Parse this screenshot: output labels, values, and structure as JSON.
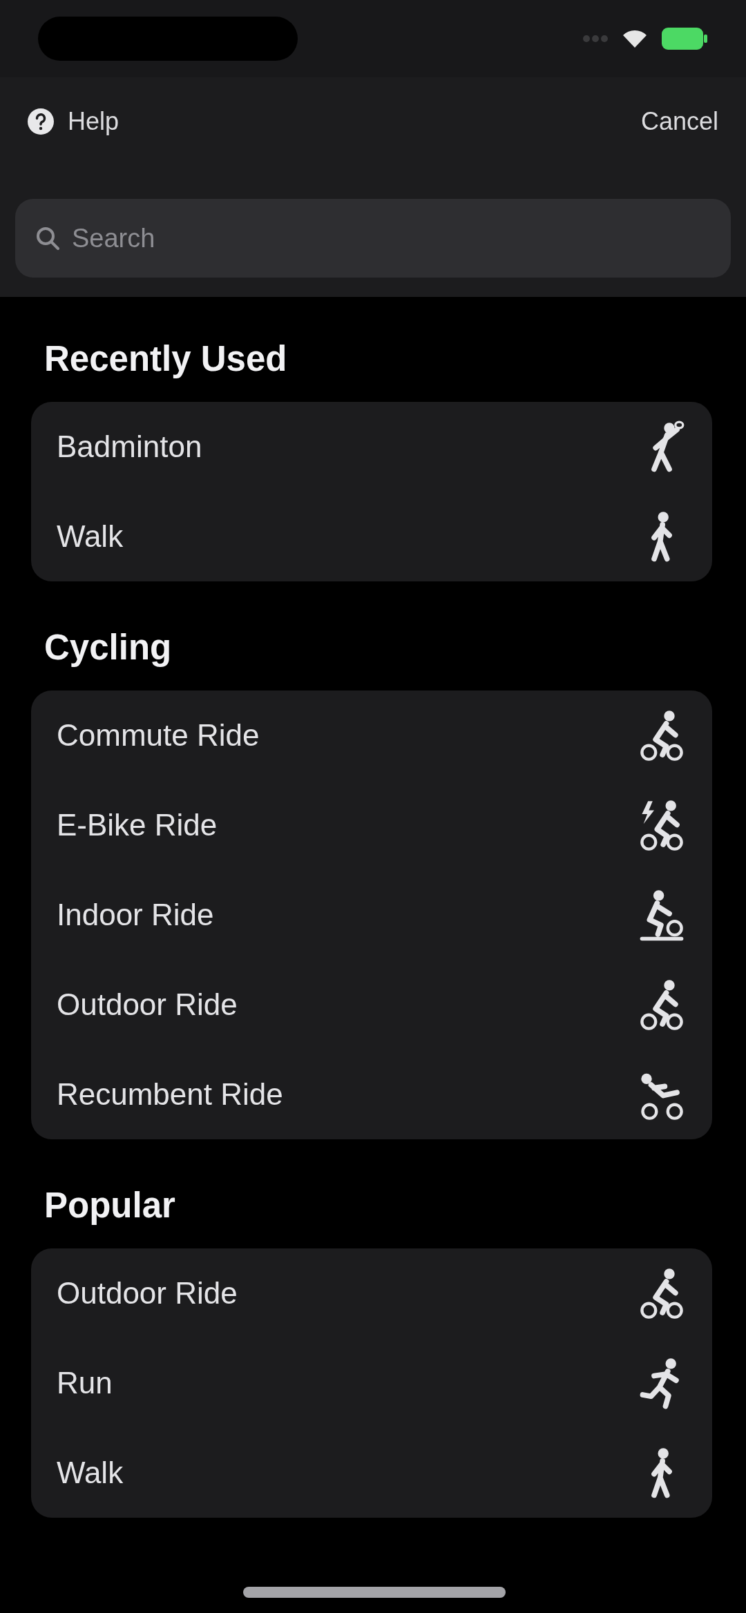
{
  "header": {
    "help": "Help",
    "cancel": "Cancel"
  },
  "search": {
    "placeholder": "Search"
  },
  "sections": [
    {
      "title": "Recently Used",
      "items": [
        {
          "label": "Badminton",
          "kind": "badminton"
        },
        {
          "label": "Walk",
          "kind": "walk"
        }
      ]
    },
    {
      "title": "Cycling",
      "items": [
        {
          "label": "Commute Ride",
          "kind": "cycling"
        },
        {
          "label": "E-Bike Ride",
          "kind": "ebike"
        },
        {
          "label": "Indoor Ride",
          "kind": "indoor_cycling"
        },
        {
          "label": "Outdoor Ride",
          "kind": "cycling"
        },
        {
          "label": "Recumbent Ride",
          "kind": "recumbent"
        }
      ]
    },
    {
      "title": "Popular",
      "items": [
        {
          "label": "Outdoor Ride",
          "kind": "cycling"
        },
        {
          "label": "Run",
          "kind": "run"
        },
        {
          "label": "Walk",
          "kind": "walk"
        }
      ]
    }
  ]
}
